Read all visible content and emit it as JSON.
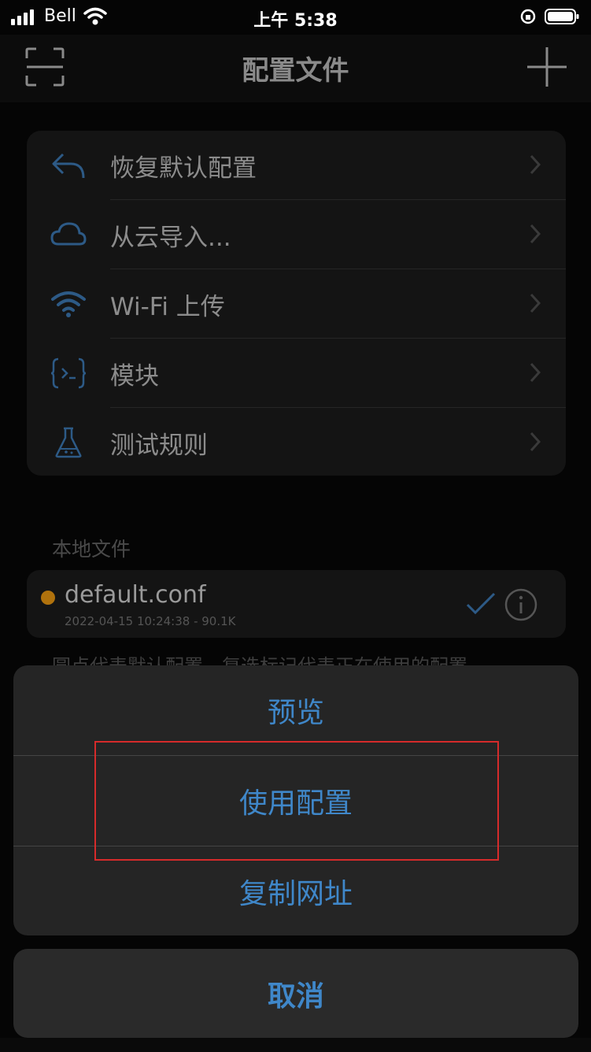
{
  "status_bar": {
    "carrier": "Bell",
    "time": "上午 5:38"
  },
  "nav": {
    "title": "配置文件",
    "left_icon": "scan-icon",
    "right_icon": "plus-icon"
  },
  "menu": {
    "items": [
      {
        "label": "恢复默认配置",
        "icon": "undo-icon"
      },
      {
        "label": "从云导入...",
        "icon": "cloud-icon"
      },
      {
        "label": "Wi-Fi 上传",
        "icon": "wifi-icon"
      },
      {
        "label": "模块",
        "icon": "module-icon"
      },
      {
        "label": "测试规则",
        "icon": "flask-icon"
      }
    ]
  },
  "local_files": {
    "header": "本地文件",
    "files": [
      {
        "name": "default.conf",
        "meta": "2022-04-15 10:24:38 - 90.1K",
        "default_dot_color": "#b0720d"
      }
    ],
    "footnote": "圆点代表默认配置，复选标记代表正在使用的配置"
  },
  "action_sheet": {
    "options": [
      "预览",
      "使用配置",
      "复制网址"
    ],
    "cancel": "取消"
  },
  "colors": {
    "accent": "#3f87c9",
    "highlight": "#d62b2b"
  }
}
